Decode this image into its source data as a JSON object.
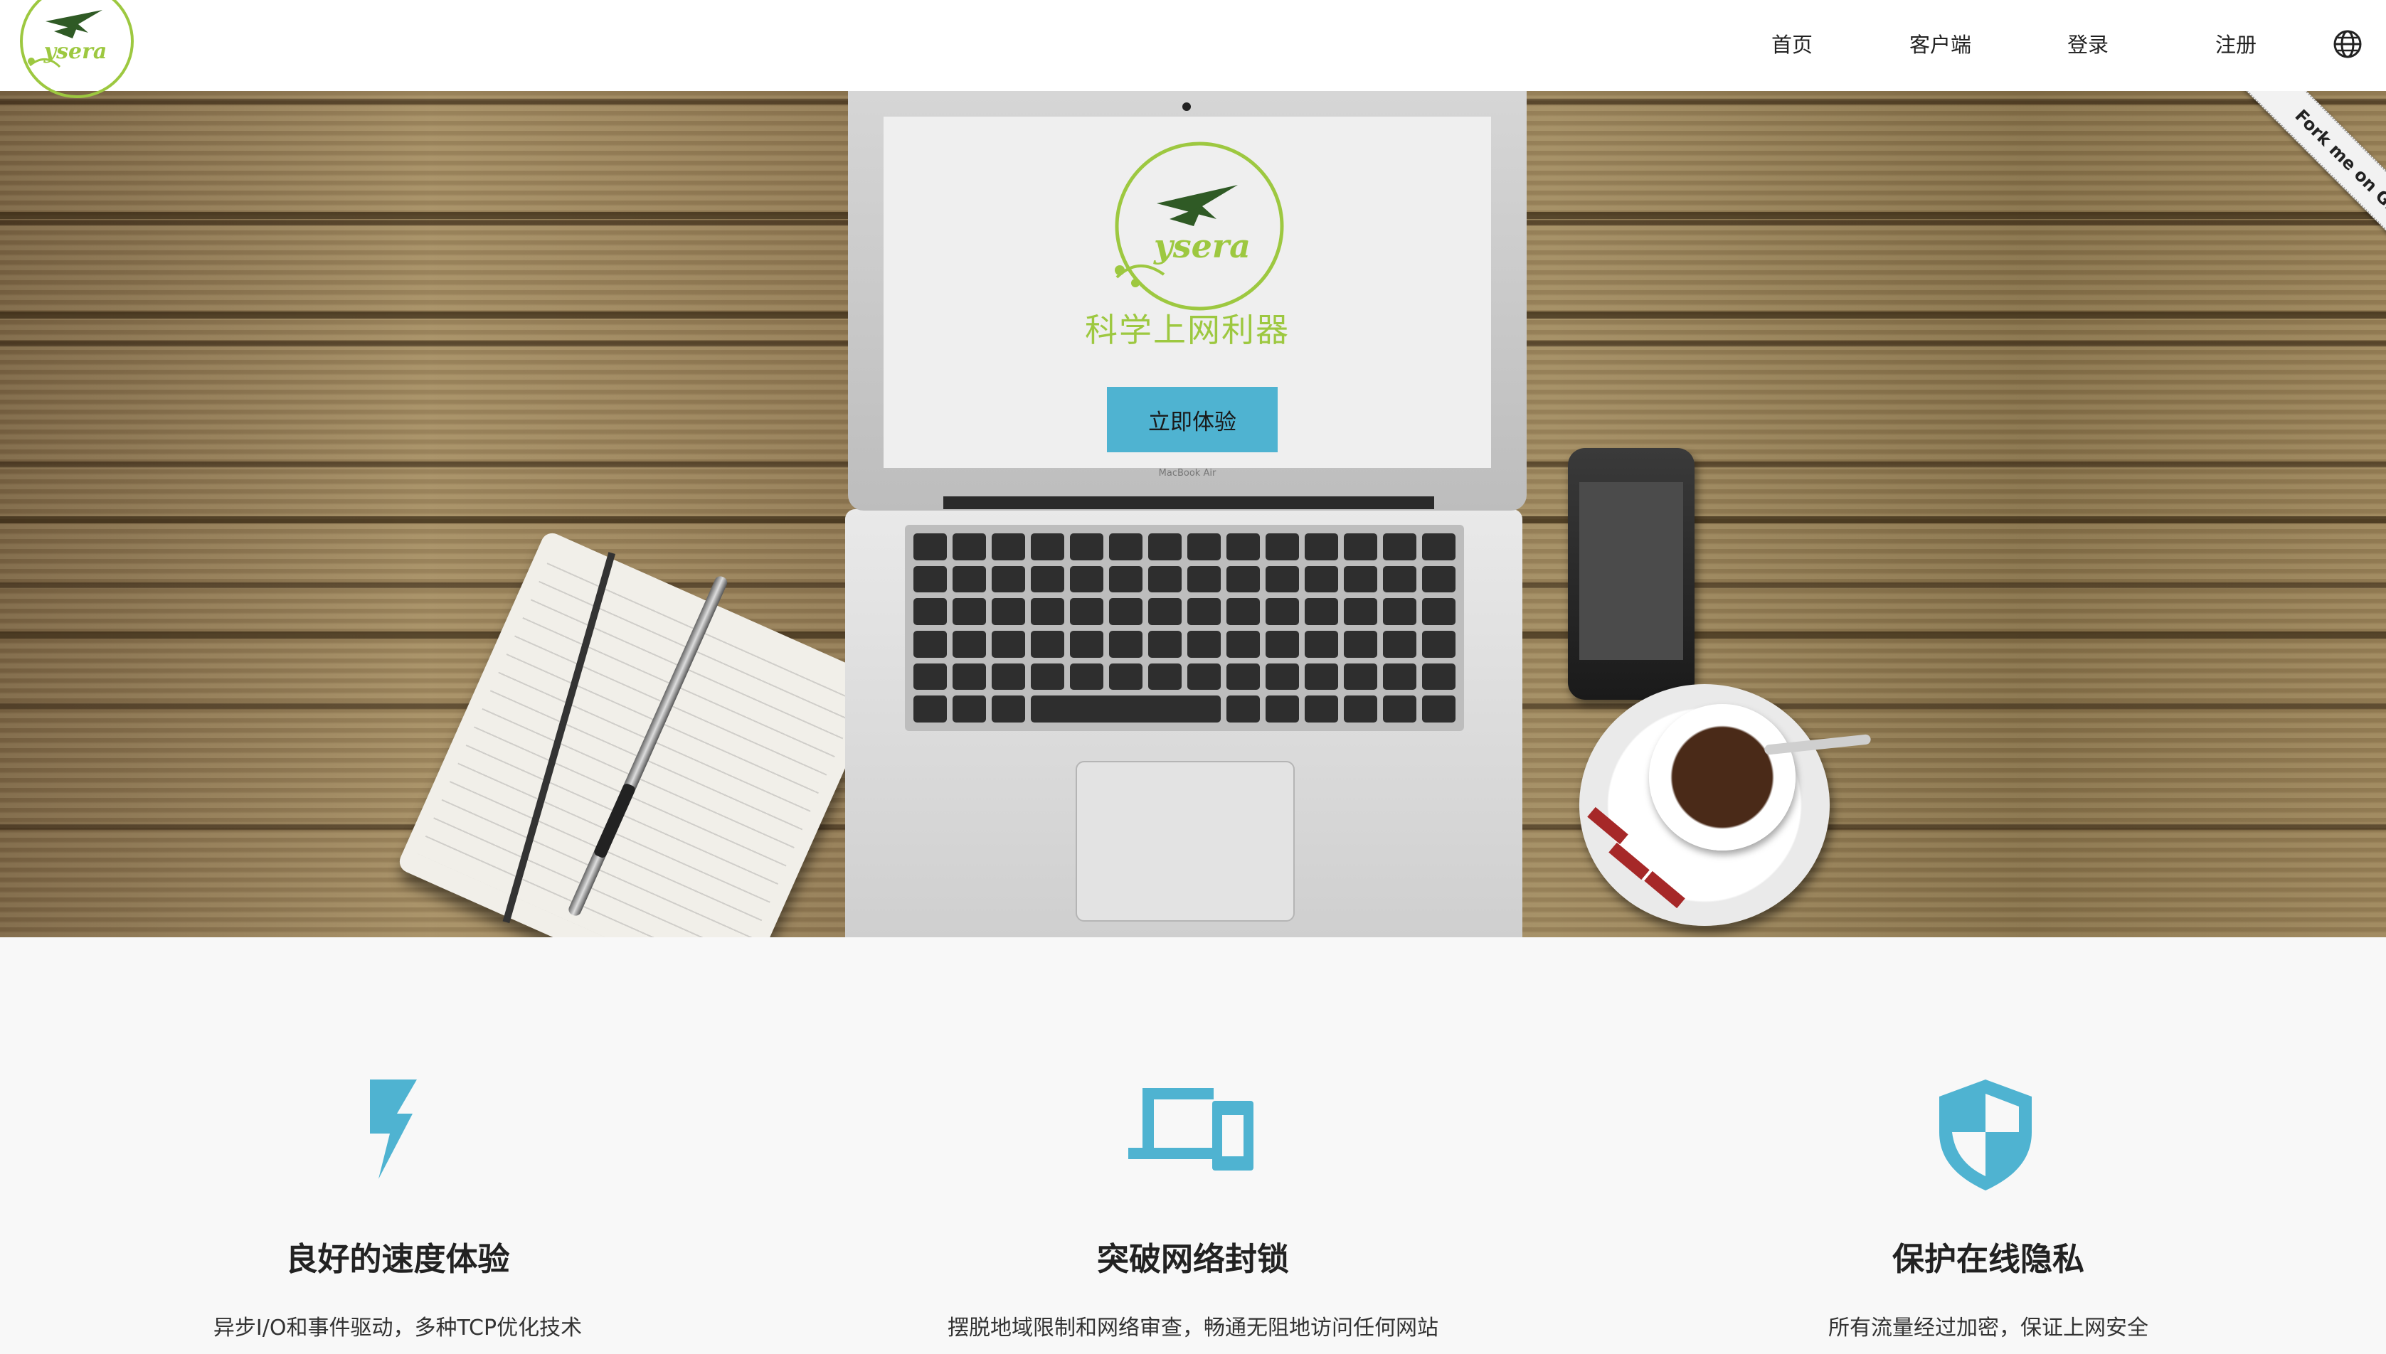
{
  "nav": {
    "items": [
      {
        "label": "首页"
      },
      {
        "label": "客户端"
      },
      {
        "label": "登录"
      },
      {
        "label": "注册"
      }
    ],
    "language_icon": "globe-icon"
  },
  "brand": {
    "logo_text": "ysera",
    "colors": {
      "logo_green": "#9dc840",
      "logo_dark": "#2f5a25",
      "accent_blue": "#4fb3d1"
    }
  },
  "hero": {
    "slogan": "科学上网利器",
    "cta_label": "立即体验",
    "laptop_label": "MacBook Air"
  },
  "ribbon": {
    "label": "Fork me on GitHub"
  },
  "features": [
    {
      "icon": "lightning-icon",
      "title": "良好的速度体验",
      "desc": "异步I/O和事件驱动，多种TCP优化技术"
    },
    {
      "icon": "devices-icon",
      "title": "突破网络封锁",
      "desc": "摆脱地域限制和网络审查，畅通无阻地访问任何网站"
    },
    {
      "icon": "shield-icon",
      "title": "保护在线隐私",
      "desc": "所有流量经过加密，保证上网安全"
    }
  ]
}
